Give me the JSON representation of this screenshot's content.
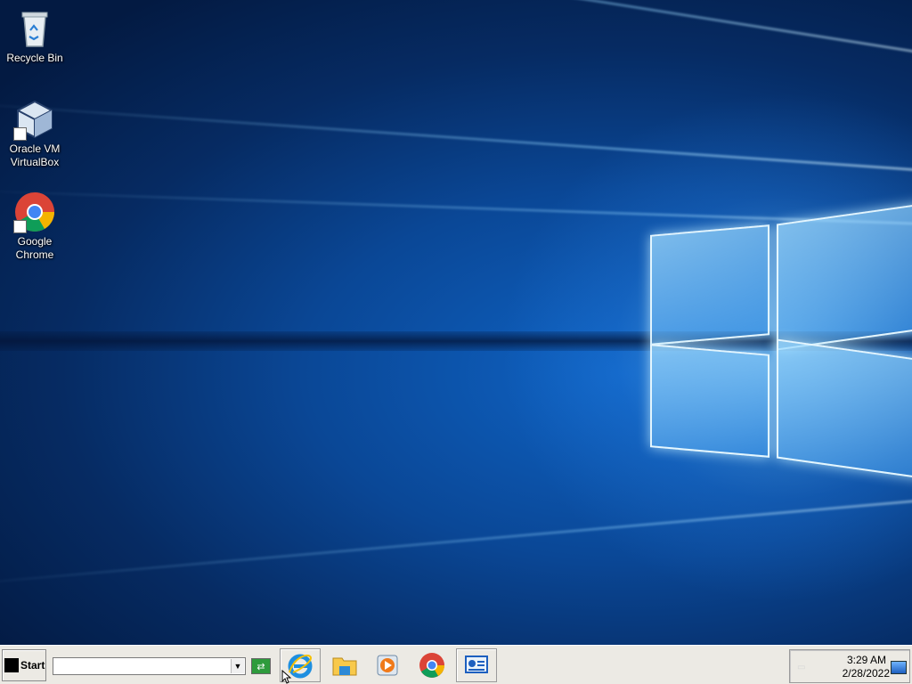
{
  "desktop": {
    "icons": [
      {
        "label": "Recycle Bin"
      },
      {
        "label": "Oracle VM\nVirtualBox"
      },
      {
        "label": "Google\nChrome"
      }
    ]
  },
  "taskbar": {
    "start_label": "Start",
    "address_value": "",
    "pinned": [
      {
        "icon": "internet-explorer-icon"
      },
      {
        "icon": "file-explorer-icon"
      },
      {
        "icon": "media-player-icon"
      },
      {
        "icon": "chrome-icon"
      },
      {
        "icon": "control-panel-icon"
      }
    ]
  },
  "tray": {
    "time": "3:29 AM",
    "date": "2/28/2022"
  },
  "colors": {
    "desktop_blue": "#0a4796",
    "taskbar": "#eceae4",
    "accent": "#1d5fbf"
  }
}
